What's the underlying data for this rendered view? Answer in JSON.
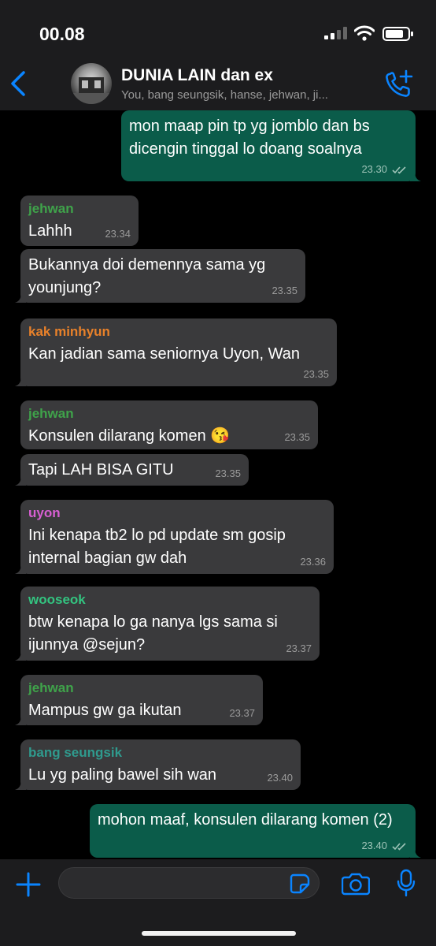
{
  "status_bar": {
    "time": "00.08"
  },
  "header": {
    "title": "DUNIA LAIN dan ex",
    "subtitle": "You, bang seungsik, hanse, jehwan, ji..."
  },
  "messages": [
    {
      "dir": "out",
      "text": "mon maap pin tp yg jomblo dan bs dicengin tinggal lo doang soalnya",
      "time": "23.30"
    },
    {
      "dir": "in",
      "sender": "jehwan",
      "text": "Lahhh",
      "time": "23.34"
    },
    {
      "dir": "in",
      "text": "Bukannya doi demennya sama yg younjung?",
      "time": "23.35"
    },
    {
      "dir": "in",
      "sender": "kak minhyun",
      "text": "Kan jadian sama seniornya Uyon, Wan",
      "time": "23.35"
    },
    {
      "dir": "in",
      "sender": "jehwan",
      "text": "Konsulen dilarang komen 😘",
      "time": "23.35"
    },
    {
      "dir": "in",
      "text": "Tapi LAH BISA GITU",
      "time": "23.35"
    },
    {
      "dir": "in",
      "sender": "uyon",
      "text": "Ini kenapa tb2 lo pd update sm gosip internal bagian gw dah",
      "time": "23.36"
    },
    {
      "dir": "in",
      "sender": "wooseok",
      "text": "btw kenapa lo ga nanya lgs sama si ijunnya @sejun?",
      "time": "23.37"
    },
    {
      "dir": "in",
      "sender": "jehwan",
      "text": "Mampus gw ga ikutan",
      "time": "23.37"
    },
    {
      "dir": "in",
      "sender": "bang seungsik",
      "text": "Lu yg paling bawel sih wan",
      "time": "23.40"
    },
    {
      "dir": "out",
      "text": "mohon maaf, konsulen dilarang komen (2)",
      "time": "23.40"
    }
  ],
  "sender_colors": {
    "jehwan": "#3fa34a",
    "kak minhyun": "#e8812a",
    "uyon": "#d85fd3",
    "wooseok": "#33c480",
    "bang seungsik": "#2f9b8e"
  },
  "icons": [
    "back-chevron-icon",
    "add-call-icon",
    "plus-icon",
    "sticker-icon",
    "camera-icon",
    "microphone-icon",
    "read-ticks-icon"
  ]
}
